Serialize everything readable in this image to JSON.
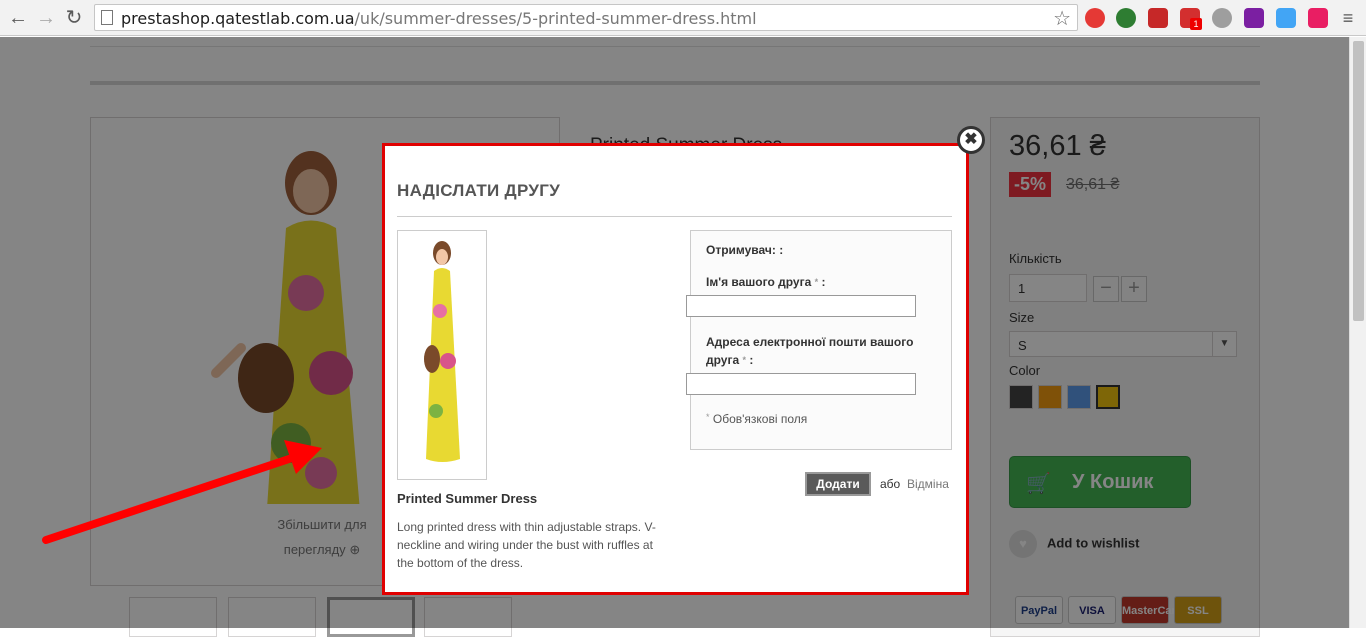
{
  "browser": {
    "url_host": "prestashop.qatestlab.com.ua",
    "url_path": "/uk/summer-dresses/5-printed-summer-dress.html",
    "ext_badge": "1"
  },
  "product": {
    "title_peek": "Printed Summer Dress",
    "zoom_label": "Збільшити для перегляду",
    "price": "36,61 ₴",
    "discount": "-5%",
    "old_price": "36,61 ₴",
    "quantity_label": "Кількість",
    "quantity_value": "1",
    "size_label": "Size",
    "size_value": "S",
    "color_label": "Color",
    "colors": [
      "#434343",
      "#f39c11",
      "#5d9cec",
      "#f1c40f"
    ],
    "cart_label": "У Кошик",
    "wishlist_label": "Add to wishlist",
    "cards": [
      "PayPal",
      "VISA",
      "MasterCard",
      "SSL"
    ]
  },
  "modal": {
    "title": "НАДІСЛАТИ ДРУГУ",
    "product_name": "Printed Summer Dress",
    "description": "Long printed dress with thin adjustable straps. V-neckline and wiring under the bust with ruffles at the bottom of the dress.",
    "recipient_label": "Отримувач: :",
    "friend_name_label": "Ім'я вашого друга",
    "friend_email_label_1": "Адреса електронної пошти вашого",
    "friend_email_label_2": "друга",
    "required_mark": "*",
    "colon": " :",
    "required_note": "Обов'язкові поля",
    "submit_label": "Додати",
    "or_label": "або",
    "cancel_label": "Відміна",
    "close_icon": "close-icon"
  },
  "colors": {
    "modal_border": "#e00000",
    "annotation_arrow": "#ff0000",
    "discount_bg": "#f13340",
    "cart_bg": "#43b754"
  }
}
